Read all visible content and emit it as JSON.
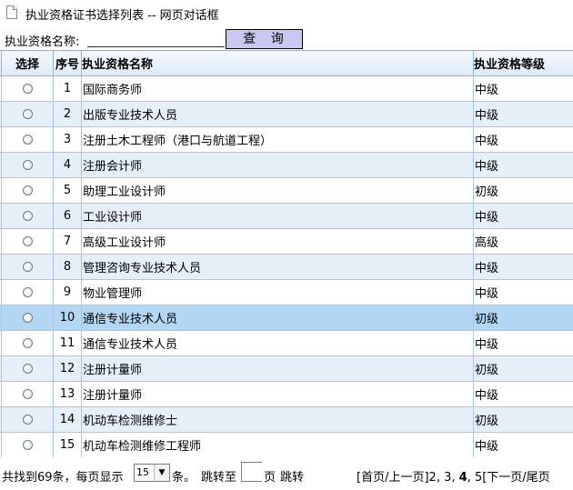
{
  "window": {
    "title": "执业资格证书选择列表 -- 网页对话框"
  },
  "search": {
    "label": "执业资格名称:",
    "value": "",
    "button_label": "查 询"
  },
  "table": {
    "headers": {
      "select": "选择",
      "num": "序号",
      "name": "执业资格名称",
      "level": "执业资格等级"
    },
    "rows": [
      {
        "num": "1",
        "name": "国际商务师",
        "level": "中级"
      },
      {
        "num": "2",
        "name": "出版专业技术人员",
        "level": "中级"
      },
      {
        "num": "3",
        "name": "注册土木工程师（港口与航道工程）",
        "level": "中级"
      },
      {
        "num": "4",
        "name": "注册会计师",
        "level": "中级"
      },
      {
        "num": "5",
        "name": "助理工业设计师",
        "level": "初级"
      },
      {
        "num": "6",
        "name": "工业设计师",
        "level": "中级"
      },
      {
        "num": "7",
        "name": "高级工业设计师",
        "level": "高级"
      },
      {
        "num": "8",
        "name": "管理咨询专业技术人员",
        "level": "中级"
      },
      {
        "num": "9",
        "name": "物业管理师",
        "level": "中级"
      },
      {
        "num": "10",
        "name": "通信专业技术人员",
        "level": "初级"
      },
      {
        "num": "11",
        "name": "通信专业技术人员",
        "level": "中级"
      },
      {
        "num": "12",
        "name": "注册计量师",
        "level": "初级"
      },
      {
        "num": "13",
        "name": "注册计量师",
        "level": "中级"
      },
      {
        "num": "14",
        "name": "机动车检测维修士",
        "level": "初级"
      },
      {
        "num": "15",
        "name": "机动车检测维修工程师",
        "level": "中级"
      }
    ],
    "selected_row": "10"
  },
  "pager": {
    "found_text": "共找到69条，每页显示",
    "page_size": "15",
    "per_text": "条。",
    "jump_text": "跳转至",
    "page_unit": "页",
    "go_text": "跳转",
    "first_prev": "[首页/上一页]",
    "pages": [
      "2",
      "3",
      "4",
      "5"
    ],
    "current_page": "4",
    "next_last": "[下一页/尾页"
  },
  "colors": {
    "header_border": "#8fb3d9",
    "even_row": "#e6eef8",
    "selected_row": "#b3d7f2",
    "search_button": "#c8c8f0"
  }
}
